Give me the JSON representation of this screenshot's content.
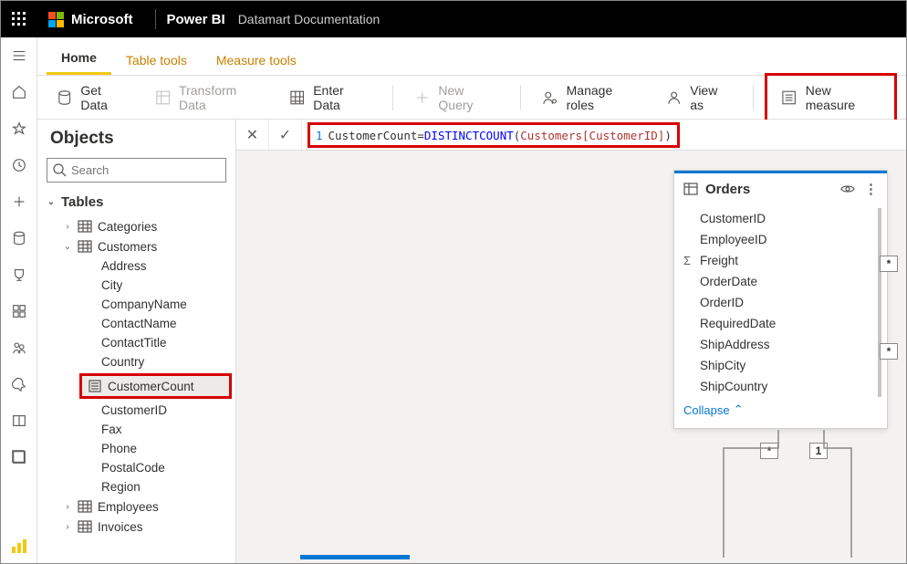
{
  "titlebar": {
    "brand": "Microsoft",
    "product": "Power BI",
    "doc": "Datamart Documentation"
  },
  "ribbonTabs": {
    "home": "Home",
    "tableTools": "Table tools",
    "measureTools": "Measure tools"
  },
  "ribbon": {
    "getData": "Get Data",
    "transformData": "Transform Data",
    "enterData": "Enter Data",
    "newQuery": "New Query",
    "manageRoles": "Manage roles",
    "viewAs": "View as",
    "newMeasure": "New measure"
  },
  "formula": {
    "lineNo": "1",
    "measureName": "CustomerCount",
    "eq": " = ",
    "func": "DISTINCTCOUNT",
    "open": "(",
    "ref": "Customers[CustomerID]",
    "close": ")"
  },
  "objects": {
    "title": "Objects",
    "searchPlaceholder": "Search",
    "tablesHeader": "Tables",
    "tables": {
      "categories": "Categories",
      "customers": "Customers",
      "employees": "Employees",
      "invoices": "Invoices"
    },
    "customerCols": {
      "address": "Address",
      "city": "City",
      "companyName": "CompanyName",
      "contactName": "ContactName",
      "contactTitle": "ContactTitle",
      "country": "Country",
      "customerCount": "CustomerCount",
      "customerId": "CustomerID",
      "fax": "Fax",
      "phone": "Phone",
      "postalCode": "PostalCode",
      "region": "Region"
    }
  },
  "ordersCard": {
    "title": "Orders",
    "collapse": "Collapse",
    "fields": {
      "customerId": "CustomerID",
      "employeeId": "EmployeeID",
      "freight": "Freight",
      "orderDate": "OrderDate",
      "orderId": "OrderID",
      "requiredDate": "RequiredDate",
      "shipAddress": "ShipAddress",
      "shipCity": "ShipCity",
      "shipCountry": "ShipCountry"
    },
    "handles": {
      "star": "*",
      "one": "1"
    }
  }
}
